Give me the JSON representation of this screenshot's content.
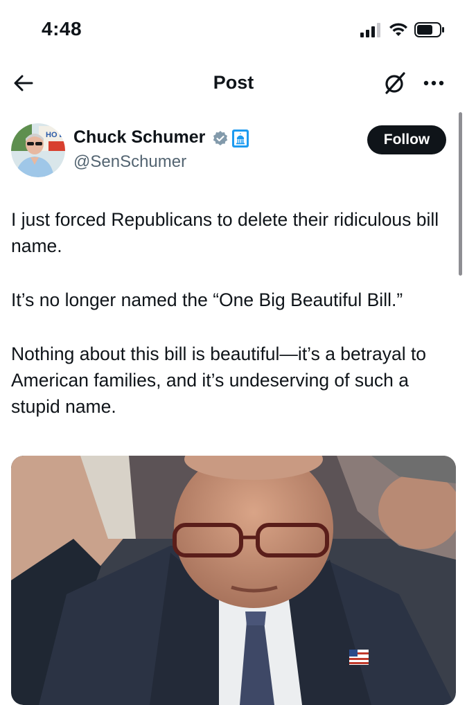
{
  "status_bar": {
    "time": "4:48"
  },
  "nav": {
    "title": "Post"
  },
  "author": {
    "name": "Chuck Schumer",
    "handle": "@SenSchumer",
    "avatar_sign_text": "HO BI"
  },
  "follow_label": "Follow",
  "post": {
    "paragraphs": [
      "I just forced Republicans to delete their ridiculous bill name.",
      "It’s no longer named the “One Big Beautiful Bill.”",
      "Nothing about this bill is beautiful—it’s a betrayal to American families, and it’s undeserving of such a stupid name."
    ]
  },
  "colors": {
    "text": "#0f1419",
    "secondary_text": "#536471",
    "verified": "#829aab",
    "gov_badge": "#1d9bf0",
    "follow_bg": "#0f1419"
  },
  "icons": [
    "back-arrow-icon",
    "grok-icon",
    "more-icon",
    "verified-badge-icon",
    "government-badge-icon",
    "signal-icon",
    "wifi-icon",
    "battery-icon"
  ]
}
